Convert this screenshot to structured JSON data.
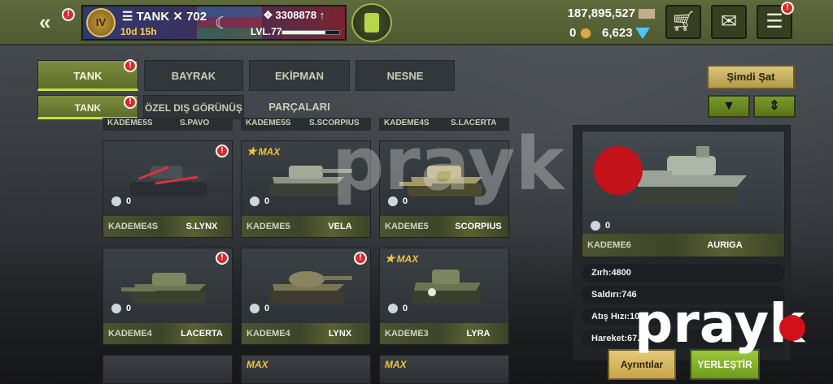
{
  "header": {
    "player_name": "TANK",
    "player_score": "702",
    "rank_badge": "IV",
    "time_left": "10d 15h",
    "xp_value": "3308878",
    "level": "LVL.77",
    "xp_progress": 0.75,
    "money": "187,895,527",
    "coins": "0",
    "gems": "6,623",
    "icons": {
      "back": "double-chevron-left-icon",
      "fuel": "fuel-can-icon",
      "shop": "cart-icon",
      "mail": "envelope-icon",
      "messages": "chat-icon"
    }
  },
  "tabs": [
    {
      "label": "TANK",
      "active": true,
      "badge": "!"
    },
    {
      "label": "BAYRAK",
      "active": false
    },
    {
      "label": "EKİPMAN PARÇALARI",
      "active": false
    },
    {
      "label": "NESNE",
      "active": false
    }
  ],
  "subtabs": [
    {
      "label": "TANK",
      "active": true,
      "badge": "!"
    },
    {
      "label": "ÖZEL DIŞ GÖRÜNÜŞ",
      "active": false
    }
  ],
  "sell_button": "Şimdi Şat",
  "previous_row": [
    {
      "tier": "KADEME5S",
      "name": "S.PAVO"
    },
    {
      "tier": "KADEME5S",
      "name": "S.SCORPIUS"
    },
    {
      "tier": "KADEME4S",
      "name": "S.LACERTA"
    }
  ],
  "cards": [
    {
      "tier": "KADEME4S",
      "name": "S.LYNX",
      "count": "0",
      "badge": "!",
      "max": ""
    },
    {
      "tier": "KADEME5",
      "name": "VELA",
      "count": "0",
      "badge": "",
      "max": "MAX"
    },
    {
      "tier": "KADEME5",
      "name": "SCORPIUS",
      "count": "0",
      "badge": "",
      "max": ""
    },
    {
      "tier": "KADEME4",
      "name": "LACERTA",
      "count": "0",
      "badge": "!",
      "max": ""
    },
    {
      "tier": "KADEME4",
      "name": "LYNX",
      "count": "0",
      "badge": "!",
      "max": ""
    },
    {
      "tier": "KADEME3",
      "name": "LYRA",
      "count": "0",
      "badge": "",
      "max": "MAX"
    }
  ],
  "next_row_max": [
    "MAX",
    "MAX"
  ],
  "detail": {
    "tier": "KADEME6",
    "name": "AURIGA",
    "count": "0",
    "stats": [
      "Zırh:4800",
      "Saldırı:746",
      "Atış Hızı:10.8",
      "Hareket:67.0"
    ]
  },
  "buttons": {
    "details": "Ayrıntılar",
    "place": "YERLEŞTİR"
  },
  "watermark": "prayk"
}
